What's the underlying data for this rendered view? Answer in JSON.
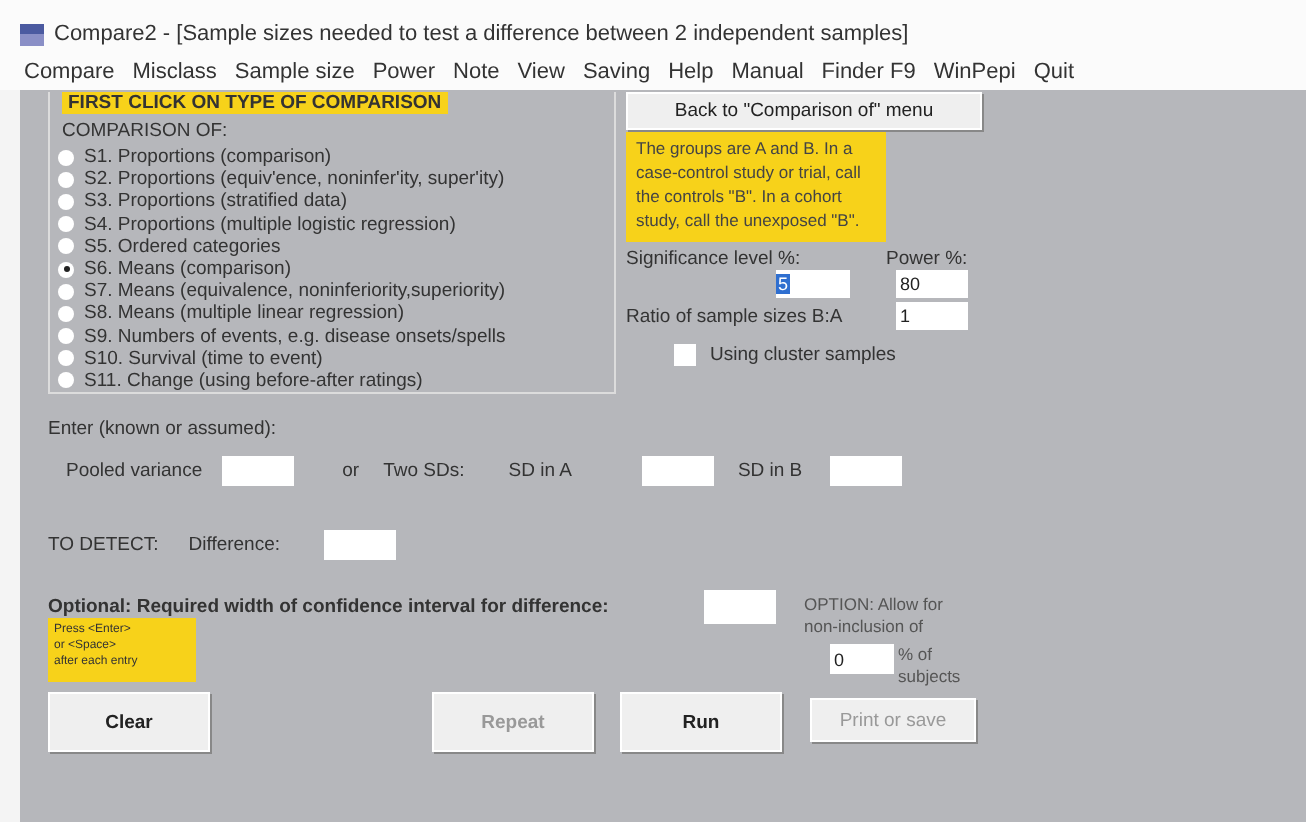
{
  "window": {
    "title": "Compare2 - [Sample sizes needed to test a difference between 2 independent samples]"
  },
  "menu": [
    "Compare",
    "Misclass",
    "Sample size",
    "Power",
    "Note",
    "View",
    "Saving",
    "Help",
    "Manual",
    "Finder F9",
    "WinPepi",
    "Quit"
  ],
  "instruction": "FIRST CLICK ON TYPE OF COMPARISON",
  "comparison": {
    "heading": "COMPARISON OF:",
    "options": [
      {
        "label": "S1. Proportions (comparison)",
        "selected": false
      },
      {
        "label": "S2. Proportions (equiv'ence, noninfer'ity, super'ity)",
        "selected": false
      },
      {
        "label": "S3. Proportions (stratified data)",
        "selected": false
      },
      {
        "label": "S4. Proportions (multiple logistic regression)",
        "selected": false
      },
      {
        "label": "S5. Ordered categories",
        "selected": false
      },
      {
        "label": "S6. Means (comparison)",
        "selected": true
      },
      {
        "label": "S7. Means (equivalence, noninferiority,superiority)",
        "selected": false
      },
      {
        "label": "S8. Means (multiple linear regression)",
        "selected": false
      },
      {
        "label": "S9. Numbers of events, e.g. disease onsets/spells",
        "selected": false
      },
      {
        "label": "S10. Survival (time to event)",
        "selected": false
      },
      {
        "label": "S11. Change (using before-after ratings)",
        "selected": false
      }
    ]
  },
  "back_button": "Back to \"Comparison of\" menu",
  "note": "The groups are A and B. In a case-control study or trial, call the controls \"B\". In a cohort study, call the unexposed \"B\".",
  "significance": {
    "label": "Significance level %:",
    "value": "5"
  },
  "power": {
    "label": "Power %:",
    "value": "80"
  },
  "ratio": {
    "label": "Ratio of sample sizes B:A",
    "value": "1"
  },
  "cluster": {
    "label": "Using cluster samples",
    "checked": false
  },
  "enter_heading": "Enter (known or assumed):",
  "pooled_variance": {
    "label": "Pooled variance"
  },
  "or": "or",
  "two_sds": "Two SDs:",
  "sd_a": {
    "label": "SD in A"
  },
  "sd_b": {
    "label": "SD in B"
  },
  "to_detect": "TO DETECT:",
  "difference": {
    "label": "Difference:"
  },
  "optional": {
    "label": "Optional: Required width of confidence interval for difference:"
  },
  "option_nonincl": {
    "label": "OPTION: Allow for non-inclusion of",
    "value": "0",
    "suffix": "% of subjects"
  },
  "hint": [
    "Press <Enter>",
    "or <Space>",
    "after each entry"
  ],
  "buttons": [
    {
      "label": "Clear",
      "disabled": false
    },
    {
      "label": "Repeat",
      "disabled": true
    },
    {
      "label": "Run",
      "disabled": false
    },
    {
      "label": "Print or save",
      "disabled": true
    }
  ]
}
